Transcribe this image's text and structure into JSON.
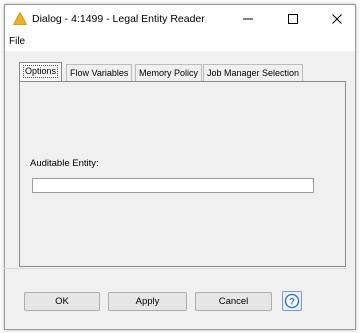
{
  "window": {
    "title": "Dialog - 4:1499 - Legal Entity Reader"
  },
  "menu": {
    "file": "File"
  },
  "tabs": [
    {
      "label": "Options"
    },
    {
      "label": "Flow Variables"
    },
    {
      "label": "Memory Policy"
    },
    {
      "label": "Job Manager Selection"
    }
  ],
  "options": {
    "auditable_entity_label": "Auditable Entity:",
    "auditable_entity_value": ""
  },
  "buttons": {
    "ok": "OK",
    "apply": "Apply",
    "cancel": "Cancel",
    "help": "?"
  },
  "icons": {
    "title": "warning-icon",
    "help": "help-icon"
  },
  "colors": {
    "warning": "#f2b01e",
    "help": "#1f6fd1"
  }
}
